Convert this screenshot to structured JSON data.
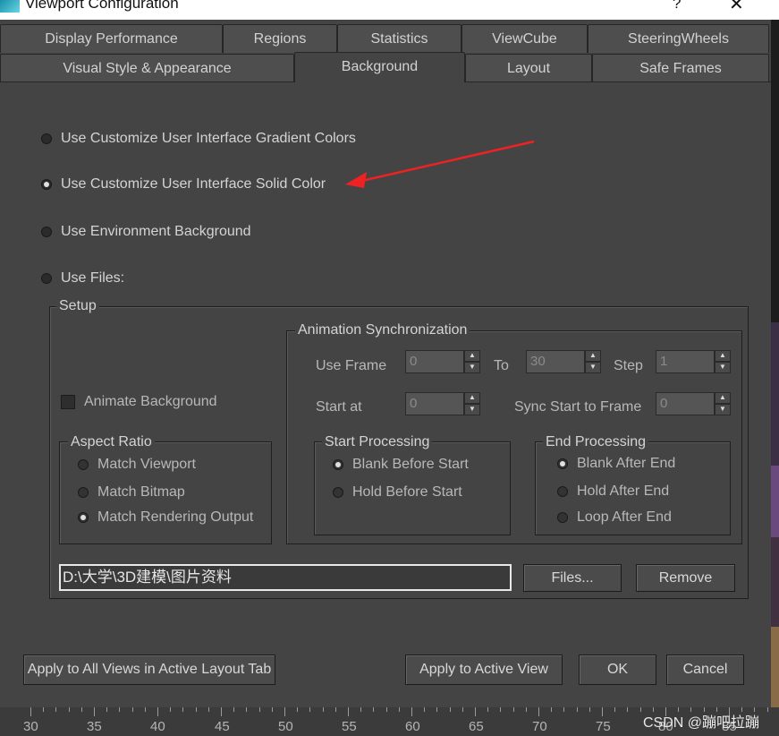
{
  "window": {
    "title": "Viewport Configuration",
    "help_glyph": "?",
    "close_glyph": "✕"
  },
  "tabs_row1": [
    "Display Performance",
    "Regions",
    "Statistics",
    "ViewCube",
    "SteeringWheels"
  ],
  "tabs_row2": [
    "Visual Style & Appearance",
    "Background",
    "Layout",
    "Safe Frames"
  ],
  "active_tab": "Background",
  "background_options": [
    {
      "label": "Use Customize User Interface Gradient Colors",
      "selected": false
    },
    {
      "label": "Use Customize User Interface Solid Color",
      "selected": true
    },
    {
      "label": "Use Environment Background",
      "selected": false
    },
    {
      "label": "Use Files:",
      "selected": false
    }
  ],
  "setup": {
    "label": "Setup",
    "animate_background": {
      "label": "Animate Background",
      "checked": false
    },
    "aspect_ratio": {
      "label": "Aspect Ratio",
      "options": [
        {
          "label": "Match Viewport",
          "selected": false
        },
        {
          "label": "Match Bitmap",
          "selected": false
        },
        {
          "label": "Match Rendering Output",
          "selected": true
        }
      ]
    },
    "animation_sync": {
      "label": "Animation Synchronization",
      "use_frame_label": "Use Frame",
      "use_frame_value": "0",
      "to_label": "To",
      "to_value": "30",
      "step_label": "Step",
      "step_value": "1",
      "start_at_label": "Start at",
      "start_at_value": "0",
      "sync_start_label": "Sync Start to Frame",
      "sync_start_value": "0"
    },
    "start_processing": {
      "label": "Start Processing",
      "options": [
        {
          "label": "Blank Before Start",
          "selected": true
        },
        {
          "label": "Hold Before Start",
          "selected": false
        }
      ]
    },
    "end_processing": {
      "label": "End Processing",
      "options": [
        {
          "label": "Blank After End",
          "selected": true
        },
        {
          "label": "Hold After End",
          "selected": false
        },
        {
          "label": "Loop After End",
          "selected": false
        }
      ]
    },
    "file_path": "D:\\大学\\3D建模\\图片资料",
    "files_button": "Files...",
    "remove_button": "Remove"
  },
  "footer": {
    "apply_all": "Apply to All Views in Active Layout Tab",
    "apply_active": "Apply to Active View",
    "ok": "OK",
    "cancel": "Cancel"
  },
  "timeline_ticks": [
    "30",
    "35",
    "40",
    "45",
    "50",
    "55",
    "60",
    "65",
    "70",
    "75",
    "80",
    "85"
  ],
  "watermark": "CSDN @蹦吧拉蹦",
  "colors": {
    "annotation_arrow": "#ee2222",
    "dialog_bg": "#444444"
  }
}
